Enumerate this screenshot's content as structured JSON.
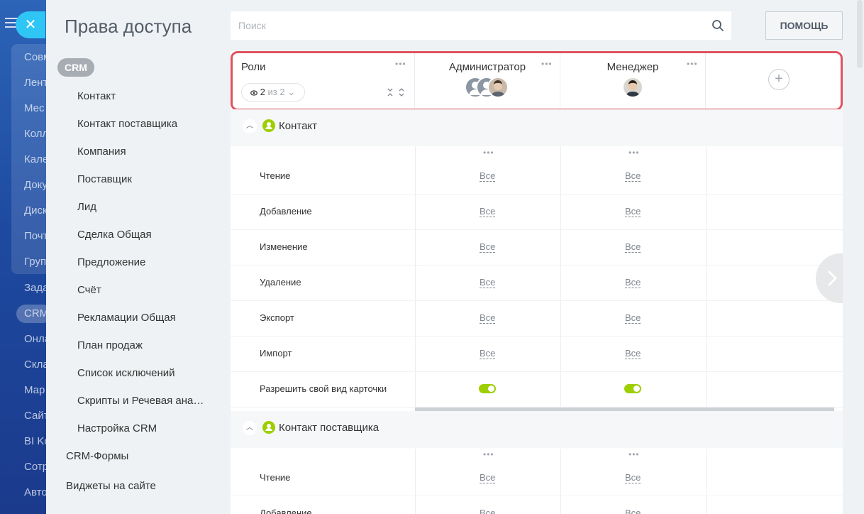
{
  "background_nav": {
    "items": [
      "Совм",
      "Лент",
      "Мес",
      "Колл",
      "Кале",
      "Доку",
      "Диск",
      "Почт",
      "Груп",
      "Зада",
      "CRM",
      "Онла",
      "Скла",
      "Мар",
      "Сайт",
      "BI Ko",
      "Сотр",
      "Авто"
    ]
  },
  "page": {
    "title": "Права доступа"
  },
  "search": {
    "placeholder": "Поиск"
  },
  "help_button": "ПОМОЩЬ",
  "sidebar": {
    "section_badge": "CRM",
    "items": [
      "Контакт",
      "Контакт поставщика",
      "Компания",
      "Поставщик",
      "Лид",
      "Сделка Общая",
      "Предложение",
      "Счёт",
      "Рекламации Общая",
      "План продаж",
      "Список исключений",
      "Скрипты и Речевая ана…",
      "Настройка CRM"
    ],
    "top_items": [
      "CRM-Формы",
      "Виджеты на сайте"
    ]
  },
  "roles_header": {
    "title": "Роли",
    "counter_value": "2",
    "counter_of": "из 2",
    "roles": [
      {
        "name": "Администратор"
      },
      {
        "name": "Менеджер"
      }
    ]
  },
  "sections": [
    {
      "title": "Контакт",
      "rows": [
        {
          "label": "Чтение",
          "admin": "Все",
          "manager": "Все"
        },
        {
          "label": "Добавление",
          "admin": "Все",
          "manager": "Все"
        },
        {
          "label": "Изменение",
          "admin": "Все",
          "manager": "Все"
        },
        {
          "label": "Удаление",
          "admin": "Все",
          "manager": "Все"
        },
        {
          "label": "Экспорт",
          "admin": "Все",
          "manager": "Все"
        },
        {
          "label": "Импорт",
          "admin": "Все",
          "manager": "Все"
        },
        {
          "label": "Разрешить свой вид карточки",
          "admin_toggle": true,
          "manager_toggle": true
        }
      ]
    },
    {
      "title": "Контакт поставщика",
      "rows": [
        {
          "label": "Чтение",
          "admin": "Все",
          "manager": "Все"
        },
        {
          "label": "Добавление",
          "admin": "Все",
          "manager": "Все"
        }
      ]
    }
  ],
  "colors": {
    "accent_green": "#9dcf00",
    "highlight_red": "#e0535f",
    "close_button": "#2fc6f6"
  }
}
